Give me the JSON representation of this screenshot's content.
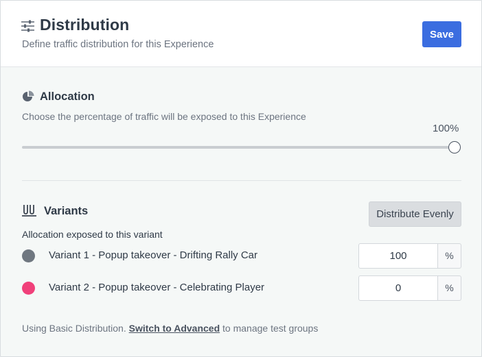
{
  "header": {
    "title": "Distribution",
    "subtitle": "Define traffic distribution for this Experience",
    "save_label": "Save",
    "icon": "sliders-icon"
  },
  "allocation": {
    "title": "Allocation",
    "icon": "pie-chart-icon",
    "description": "Choose the percentage of traffic will be exposed to this Experience",
    "value_label": "100%",
    "value": 100
  },
  "variants": {
    "title": "Variants",
    "icon": "test-tubes-icon",
    "distribute_label": "Distribute Evenly",
    "subtitle": "Allocation exposed to this variant",
    "unit": "%",
    "items": [
      {
        "name": "Variant 1 - Popup takeover - Drifting Rally Car",
        "value": "100",
        "color": "#6f7780"
      },
      {
        "name": "Variant 2 - Popup takeover - Celebrating Player",
        "value": "0",
        "color": "#f0407a"
      }
    ]
  },
  "footer": {
    "prefix": "Using Basic Distribution. ",
    "link": "Switch to Advanced",
    "suffix": " to manage test groups"
  },
  "colors": {
    "accent": "#3b6de0",
    "background": "#f5f8f7"
  }
}
